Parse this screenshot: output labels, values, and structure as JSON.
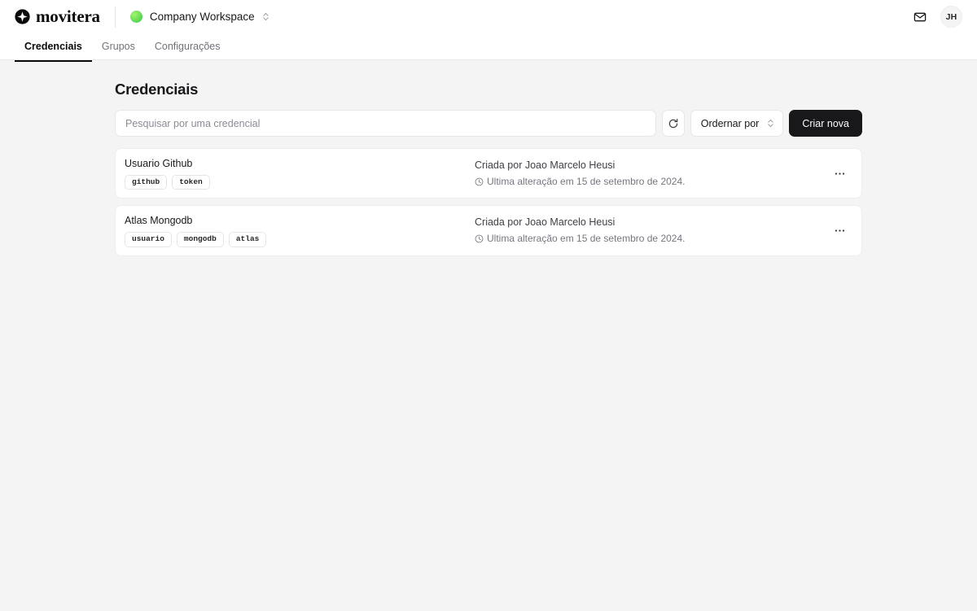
{
  "header": {
    "brand_name": "movitera",
    "brand_icon": "plus-circle-icon",
    "workspace": {
      "name": "Company Workspace",
      "dot_color": "#6fe05a",
      "chevron_icon": "chevron-up-down-icon"
    },
    "mail_icon": "mail-icon",
    "avatar_initials": "JH"
  },
  "tabs": [
    {
      "label": "Credenciais",
      "active": true
    },
    {
      "label": "Grupos",
      "active": false
    },
    {
      "label": "Configurações",
      "active": false
    }
  ],
  "main": {
    "page_title": "Credenciais",
    "toolbar": {
      "search_placeholder": "Pesquisar por uma credencial",
      "search_value": "",
      "refresh_icon": "refresh-icon",
      "sort_label": "Ordernar por",
      "sort_chevron_icon": "chevron-up-down-icon",
      "create_label": "Criar nova"
    },
    "credentials": [
      {
        "name": "Usuario Github",
        "tags": [
          "github",
          "token"
        ],
        "author": "Criada por Joao Marcelo Heusi",
        "updated": "Ultima alteração em 15 de setembro de 2024.",
        "clock_icon": "clock-icon",
        "menu_icon": "more-horizontal-icon"
      },
      {
        "name": "Atlas Mongodb",
        "tags": [
          "usuario",
          "mongodb",
          "atlas"
        ],
        "author": "Criada por Joao Marcelo Heusi",
        "updated": "Ultima alteração em 15 de setembro de 2024.",
        "clock_icon": "clock-icon",
        "menu_icon": "more-horizontal-icon"
      }
    ]
  },
  "colors": {
    "page_background": "#f4f4f5",
    "surface": "#ffffff",
    "accent_dark": "#18181b",
    "workspace_green": "#6fe05a",
    "border": "#e7e7ea",
    "muted_text": "#71717a"
  }
}
